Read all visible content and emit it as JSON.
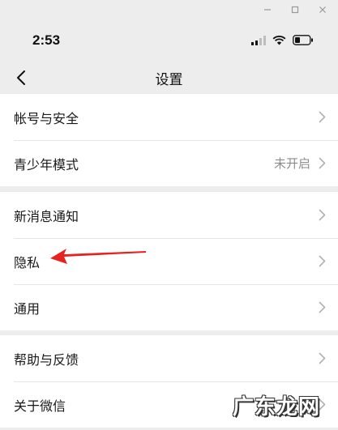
{
  "status_bar": {
    "time": "2:53"
  },
  "nav": {
    "title": "设置"
  },
  "groups": [
    {
      "items": [
        {
          "label": "帐号与安全",
          "value": ""
        },
        {
          "label": "青少年模式",
          "value": "未开启"
        }
      ]
    },
    {
      "items": [
        {
          "label": "新消息通知",
          "value": ""
        },
        {
          "label": "隐私",
          "value": ""
        },
        {
          "label": "通用",
          "value": ""
        }
      ]
    },
    {
      "items": [
        {
          "label": "帮助与反馈",
          "value": ""
        },
        {
          "label": "关于微信",
          "value": ""
        }
      ]
    }
  ],
  "watermark": {
    "text": "广东龙网"
  },
  "colors": {
    "background": "#ededed",
    "row_background": "#ffffff",
    "annotation_arrow": "#e8231f",
    "secondary_text": "#8c8c8c"
  },
  "icons": [
    "minimize-icon",
    "maximize-icon",
    "close-icon",
    "signal-icon",
    "wifi-icon",
    "battery-icon",
    "back-chevron-icon",
    "chevron-right-icon"
  ]
}
